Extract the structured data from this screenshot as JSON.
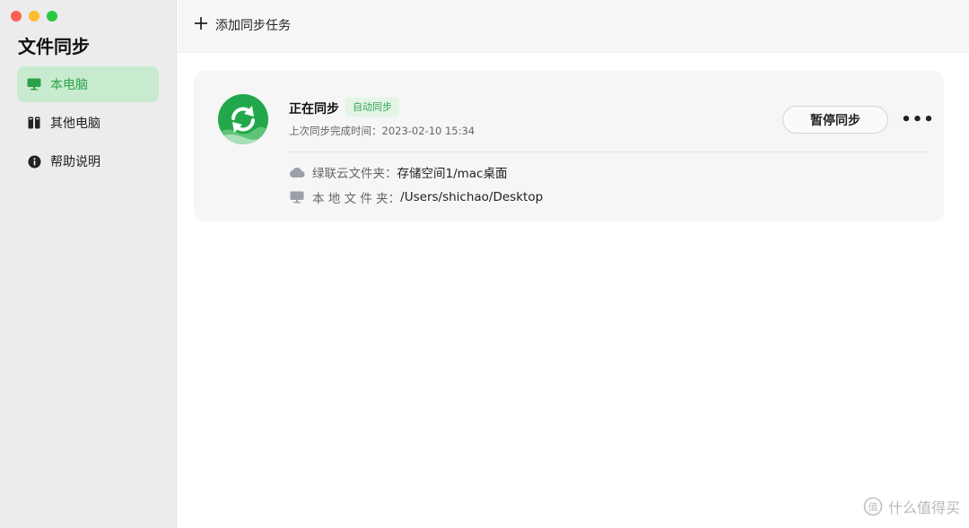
{
  "window": {
    "title": "文件同步"
  },
  "sidebar": {
    "items": [
      {
        "label": "本电脑",
        "icon": "monitor-icon",
        "active": true
      },
      {
        "label": "其他电脑",
        "icon": "computers-icon",
        "active": false
      },
      {
        "label": "帮助说明",
        "icon": "info-icon",
        "active": false
      }
    ]
  },
  "toolbar": {
    "add_label": "添加同步任务",
    "add_icon": "plus-icon"
  },
  "task": {
    "status": "正在同步",
    "badge": "自动同步",
    "last_sync": "上次同步完成时间：2023-02-10 15:34",
    "pause_label": "暂停同步",
    "more_label": "•••",
    "cloud_label": "绿联云文件夹：",
    "cloud_path": "存储空间1/mac桌面",
    "local_label": "本 地 文 件 夹：",
    "local_path": "/Users/shichao/Desktop"
  },
  "watermark": {
    "text": "什么值得买"
  },
  "colors": {
    "accent_green": "#2aa24a",
    "active_bg": "#c8ebcf",
    "badge_bg": "#e4f4e6"
  }
}
